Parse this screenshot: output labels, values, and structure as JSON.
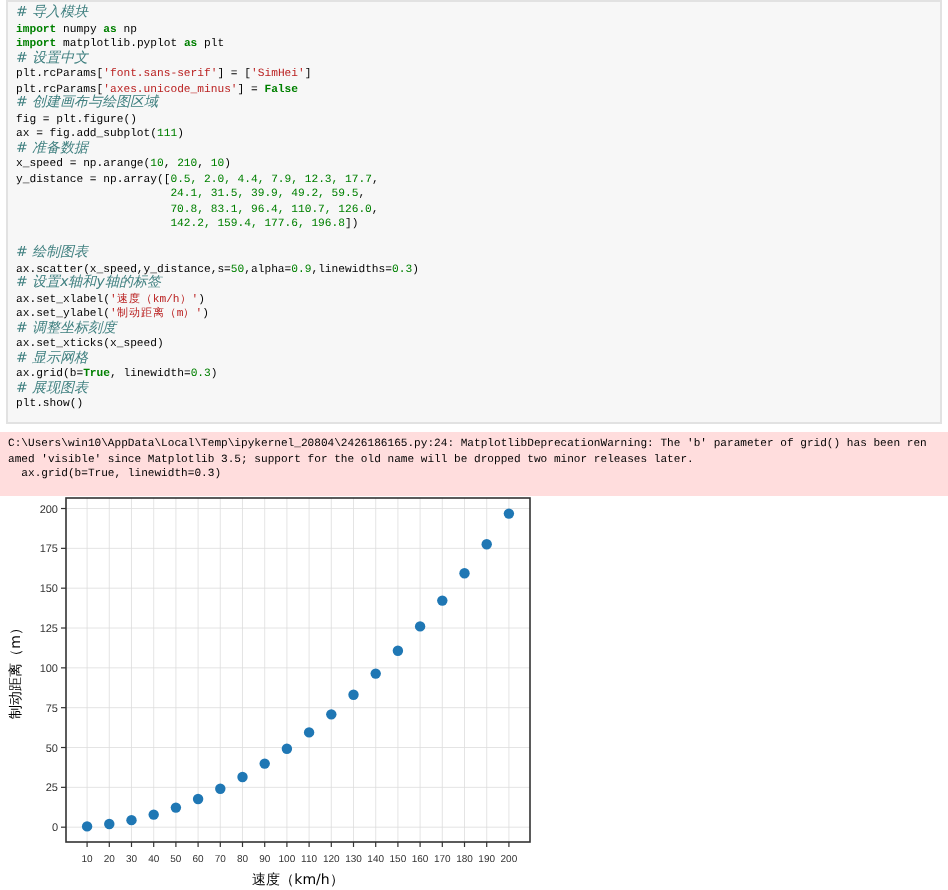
{
  "code_cell": {
    "lines": [
      {
        "continued": false,
        "gap_before": false,
        "segments": [
          {
            "kind": "comment",
            "text": "# 导入模块"
          }
        ]
      },
      {
        "continued": false,
        "gap_before": false,
        "segments": [
          {
            "kind": "keyword",
            "text": "import"
          },
          {
            "kind": "plain",
            "text": " numpy "
          },
          {
            "kind": "keyword",
            "text": "as"
          },
          {
            "kind": "plain",
            "text": " np"
          }
        ]
      },
      {
        "continued": false,
        "gap_before": false,
        "segments": [
          {
            "kind": "keyword",
            "text": "import"
          },
          {
            "kind": "plain",
            "text": " matplotlib.pyplot "
          },
          {
            "kind": "keyword",
            "text": "as"
          },
          {
            "kind": "plain",
            "text": " plt"
          }
        ]
      },
      {
        "continued": false,
        "gap_before": false,
        "segments": [
          {
            "kind": "comment",
            "text": "# 设置中文"
          }
        ]
      },
      {
        "continued": false,
        "gap_before": false,
        "segments": [
          {
            "kind": "plain",
            "text": "plt.rcParams["
          },
          {
            "kind": "string",
            "text": "'font.sans-serif'"
          },
          {
            "kind": "plain",
            "text": "] = ["
          },
          {
            "kind": "string",
            "text": "'SimHei'"
          },
          {
            "kind": "plain",
            "text": "]"
          }
        ]
      },
      {
        "continued": false,
        "gap_before": false,
        "segments": [
          {
            "kind": "plain",
            "text": "plt.rcParams["
          },
          {
            "kind": "string",
            "text": "'axes.unicode_minus'"
          },
          {
            "kind": "plain",
            "text": "] = "
          },
          {
            "kind": "keyword",
            "text": "False"
          }
        ]
      },
      {
        "continued": false,
        "gap_before": false,
        "segments": [
          {
            "kind": "comment",
            "text": "# 创建画布与绘图区域"
          }
        ]
      },
      {
        "continued": false,
        "gap_before": false,
        "segments": [
          {
            "kind": "plain",
            "text": "fig = plt.figure()"
          }
        ]
      },
      {
        "continued": false,
        "gap_before": false,
        "segments": [
          {
            "kind": "plain",
            "text": "ax = fig.add_subplot("
          },
          {
            "kind": "number",
            "text": "111"
          },
          {
            "kind": "plain",
            "text": ")"
          }
        ]
      },
      {
        "continued": false,
        "gap_before": false,
        "segments": [
          {
            "kind": "comment",
            "text": "# 准备数据"
          }
        ]
      },
      {
        "continued": false,
        "gap_before": false,
        "segments": [
          {
            "kind": "plain",
            "text": "x_speed = np.arange("
          },
          {
            "kind": "number",
            "text": "10"
          },
          {
            "kind": "plain",
            "text": ", "
          },
          {
            "kind": "number",
            "text": "210"
          },
          {
            "kind": "plain",
            "text": ", "
          },
          {
            "kind": "number",
            "text": "10"
          },
          {
            "kind": "plain",
            "text": ")"
          }
        ]
      },
      {
        "continued": false,
        "gap_before": false,
        "segments": [
          {
            "kind": "plain",
            "text": "y_distance = np.array(["
          },
          {
            "kind": "number",
            "text": "0.5, 2.0, 4.4, 7.9, 12.3, 17.7"
          },
          {
            "kind": "plain",
            "text": ","
          }
        ]
      },
      {
        "continued": true,
        "gap_before": false,
        "segments": [
          {
            "kind": "number",
            "text": "24.1, 31.5, 39.9, 49.2, 59.5"
          },
          {
            "kind": "plain",
            "text": ","
          }
        ]
      },
      {
        "continued": true,
        "gap_before": false,
        "segments": [
          {
            "kind": "number",
            "text": "70.8, 83.1, 96.4, 110.7, 126.0"
          },
          {
            "kind": "plain",
            "text": ","
          }
        ]
      },
      {
        "continued": true,
        "gap_before": false,
        "segments": [
          {
            "kind": "number",
            "text": "142.2, 159.4, 177.6, 196.8"
          },
          {
            "kind": "plain",
            "text": "])"
          }
        ]
      },
      {
        "continued": false,
        "gap_before": true,
        "segments": [
          {
            "kind": "comment",
            "text": "# 绘制图表"
          }
        ]
      },
      {
        "continued": false,
        "gap_before": false,
        "segments": [
          {
            "kind": "plain",
            "text": "ax.scatter(x_speed,y_distance,s="
          },
          {
            "kind": "number",
            "text": "50"
          },
          {
            "kind": "plain",
            "text": ",alpha="
          },
          {
            "kind": "number",
            "text": "0.9"
          },
          {
            "kind": "plain",
            "text": ",linewidths="
          },
          {
            "kind": "number",
            "text": "0.3"
          },
          {
            "kind": "plain",
            "text": ")"
          }
        ]
      },
      {
        "continued": false,
        "gap_before": false,
        "segments": [
          {
            "kind": "comment",
            "text": "# 设置x轴和y轴的标签"
          }
        ]
      },
      {
        "continued": false,
        "gap_before": false,
        "segments": [
          {
            "kind": "plain",
            "text": "ax.set_xlabel("
          },
          {
            "kind": "string",
            "text": "'速度（km/h）'"
          },
          {
            "kind": "plain",
            "text": ")"
          }
        ]
      },
      {
        "continued": false,
        "gap_before": false,
        "segments": [
          {
            "kind": "plain",
            "text": "ax.set_ylabel("
          },
          {
            "kind": "string",
            "text": "'制动距离（m）'"
          },
          {
            "kind": "plain",
            "text": ")"
          }
        ]
      },
      {
        "continued": false,
        "gap_before": false,
        "segments": [
          {
            "kind": "comment",
            "text": "# 调整坐标刻度"
          }
        ]
      },
      {
        "continued": false,
        "gap_before": false,
        "segments": [
          {
            "kind": "plain",
            "text": "ax.set_xticks(x_speed)"
          }
        ]
      },
      {
        "continued": false,
        "gap_before": false,
        "segments": [
          {
            "kind": "comment",
            "text": "# 显示网格"
          }
        ]
      },
      {
        "continued": false,
        "gap_before": false,
        "segments": [
          {
            "kind": "plain",
            "text": "ax.grid(b="
          },
          {
            "kind": "keyword",
            "text": "True"
          },
          {
            "kind": "plain",
            "text": ", linewidth="
          },
          {
            "kind": "number",
            "text": "0.3"
          },
          {
            "kind": "plain",
            "text": ")"
          }
        ]
      },
      {
        "continued": false,
        "gap_before": false,
        "segments": [
          {
            "kind": "comment",
            "text": "# 展现图表"
          }
        ]
      },
      {
        "continued": false,
        "gap_before": false,
        "segments": [
          {
            "kind": "plain",
            "text": "plt.show()"
          }
        ]
      }
    ]
  },
  "warning_output": {
    "lines": [
      "C:\\Users\\win10\\AppData\\Local\\Temp\\ipykernel_20804\\2426186165.py:24: MatplotlibDeprecationWarning: The 'b' parameter of grid() has been ren",
      "amed 'visible' since Matplotlib 3.5; support for the old name will be dropped two minor releases later.",
      "  ax.grid(b=True, linewidth=0.3)"
    ]
  },
  "figure": {
    "chart_data": {
      "type": "scatter",
      "xlabel": "速度（km/h）",
      "ylabel": "制动距离（m）",
      "grid": true,
      "x": [
        10,
        20,
        30,
        40,
        50,
        60,
        70,
        80,
        90,
        100,
        110,
        120,
        130,
        140,
        150,
        160,
        170,
        180,
        190,
        200
      ],
      "series": [
        {
          "color": "#1f77b4",
          "values": [
            0.5,
            2,
            4.4,
            7.9,
            12.3,
            17.7,
            24.1,
            31.5,
            39.9,
            49.2,
            59.5,
            70.8,
            83.1,
            96.4,
            110.7,
            126,
            142.2,
            159.4,
            177.6,
            196.8
          ]
        }
      ],
      "xlim": [
        0.5,
        209.5
      ],
      "ylim": [
        -9.3,
        206.6
      ],
      "xticks": [
        10,
        20,
        30,
        40,
        50,
        60,
        70,
        80,
        90,
        100,
        110,
        120,
        130,
        140,
        150,
        160,
        170,
        180,
        190,
        200
      ],
      "yticks": [
        0,
        25,
        50,
        75,
        100,
        125,
        150,
        175,
        200
      ]
    }
  }
}
